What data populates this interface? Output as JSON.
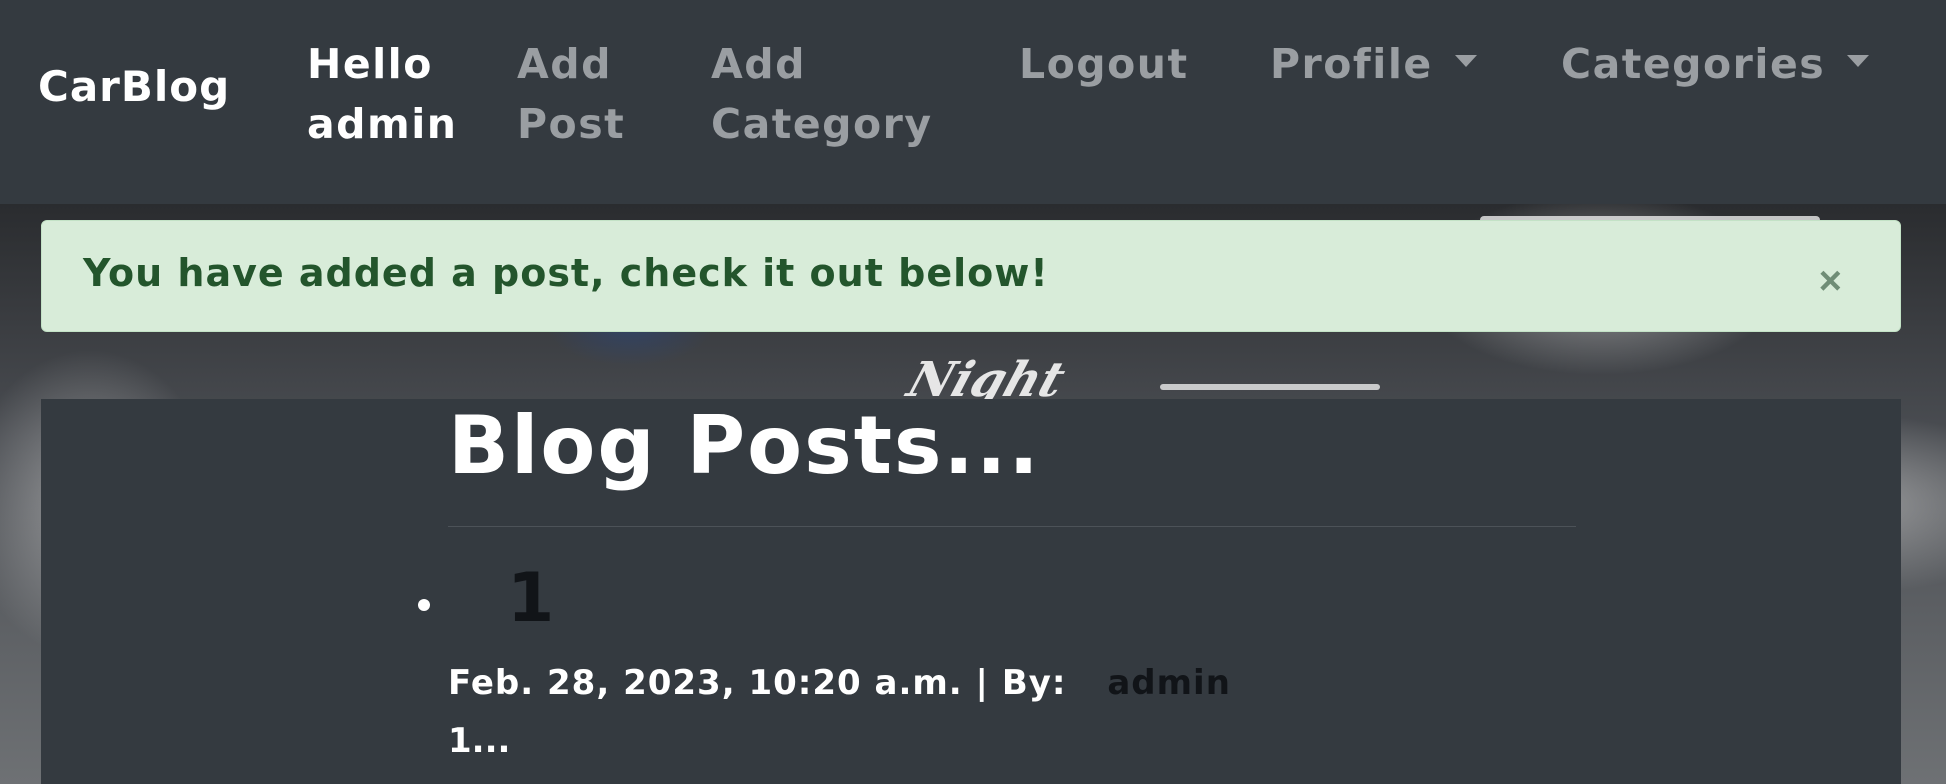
{
  "navbar": {
    "brand": "CarBlog",
    "greeting": "Hello admin",
    "add_post": "Add Post",
    "add_category": "Add Category",
    "logout": "Logout",
    "profile": "Profile",
    "categories": "Categories"
  },
  "alert": {
    "message": "You have added a post, check it out below!",
    "close": "×",
    "type": "success"
  },
  "main": {
    "heading": "Blog Posts...",
    "posts": [
      {
        "title": "1",
        "date": "Feb. 28, 2023, 10:20 a.m. |",
        "by_label": "By:",
        "author": "admin",
        "excerpt": "1..."
      }
    ]
  },
  "colors": {
    "navbar_bg": "#343a40",
    "alert_bg": "#d8ecd9",
    "alert_text": "#23552c",
    "nav_active": "#ffffff",
    "nav_inactive": "#9a9ea2"
  }
}
